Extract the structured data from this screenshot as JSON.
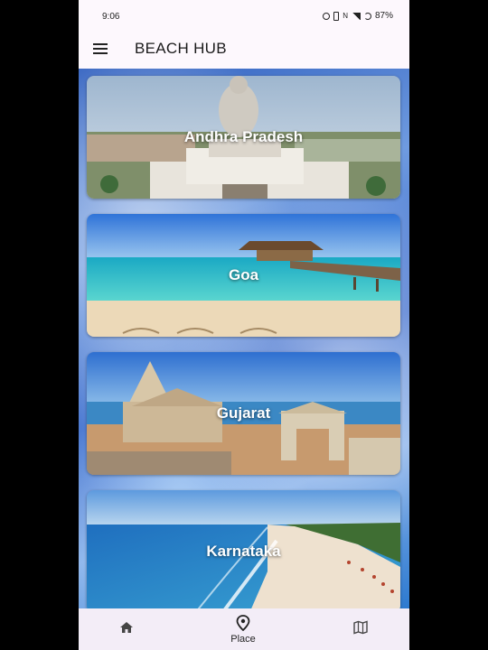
{
  "status": {
    "time": "9:06",
    "battery": "87%"
  },
  "appbar": {
    "title": "BEACH HUB",
    "menu_icon": "menu-icon"
  },
  "places": [
    {
      "name": "Andhra Pradesh"
    },
    {
      "name": "Goa"
    },
    {
      "name": "Gujarat"
    },
    {
      "name": "Karnataka"
    }
  ],
  "nav": {
    "items": [
      {
        "icon": "home-icon",
        "label": ""
      },
      {
        "icon": "location-pin-icon",
        "label": "Place"
      },
      {
        "icon": "map-icon",
        "label": ""
      }
    ]
  }
}
